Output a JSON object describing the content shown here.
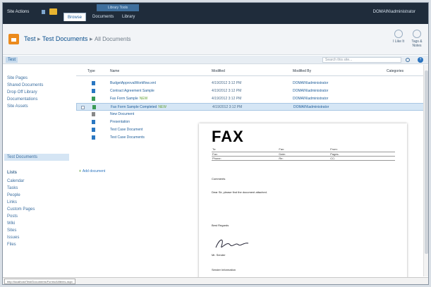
{
  "topbar": {
    "site_actions": "Site Actions",
    "ribbon_group": "Library Tools",
    "tabs": [
      "Browse",
      "Documents",
      "Library"
    ],
    "user": "DOMAIN\\administrator"
  },
  "title": {
    "site": "Test",
    "library": "Test Documents",
    "view": "All Documents"
  },
  "ribbon_right": [
    "I Like It",
    "Tags & Notes"
  ],
  "searchbar": {
    "home": "Test",
    "search_placeholder": "Search this site..."
  },
  "leftnav": {
    "items": [
      "Site Pages",
      "Shared Documents",
      "Drop Off Library",
      "Documentations",
      "Site Assets",
      "Test Documents"
    ],
    "lists_head": "Lists",
    "lists": [
      "Calendar",
      "Tasks",
      "People",
      "Links",
      "Custom Pages",
      "Posts",
      "Wiki",
      "Sites",
      "Issues",
      "Files"
    ]
  },
  "columns": [
    "Type",
    "Name",
    "Modified",
    "Modified By",
    "Categories"
  ],
  "rows": [
    {
      "name": "BudgetApprovalWorkflow.xml",
      "modified": "4/19/2012 3:12 PM",
      "by": "DOMAIN\\administrator",
      "new": false,
      "icon": "blue"
    },
    {
      "name": "Contract Agreement Sample",
      "modified": "4/19/2012 3:12 PM",
      "by": "DOMAIN\\administrator",
      "new": false,
      "icon": "blue"
    },
    {
      "name": "Fax Form Sample",
      "modified": "4/19/2012 3:12 PM",
      "by": "DOMAIN\\administrator",
      "new": true,
      "icon": "green"
    },
    {
      "name": "Fax Form Sample Completed",
      "modified": "4/19/2012 3:12 PM",
      "by": "DOMAIN\\administrator",
      "new": true,
      "icon": "green",
      "selected": true
    },
    {
      "name": "New Document",
      "modified": "",
      "by": "",
      "new": false,
      "icon": "gray"
    },
    {
      "name": "Presentation",
      "modified": "",
      "by": "",
      "new": false,
      "icon": "blue"
    },
    {
      "name": "Test Case Document",
      "modified": "",
      "by": "",
      "new": false,
      "icon": "blue"
    },
    {
      "name": "Test Case Documents",
      "modified": "",
      "by": "",
      "new": false,
      "icon": "blue"
    }
  ],
  "new_badge": "NEW",
  "add_document": "Add document",
  "fax": {
    "title": "FAX",
    "fields": [
      [
        "To:",
        "Fax:",
        "From:"
      ],
      [
        "Fax:",
        "Date:",
        "Pages:"
      ],
      [
        "Phone:",
        "Re:",
        "CC:"
      ]
    ],
    "lines": [
      "Comments",
      "Dear Sir, please find the document attached.",
      "Best Regards",
      "Mr. Sender",
      "Sender Information"
    ]
  },
  "status_url": "http://localhost/Test/Documents/Forms/AllItems.aspx"
}
